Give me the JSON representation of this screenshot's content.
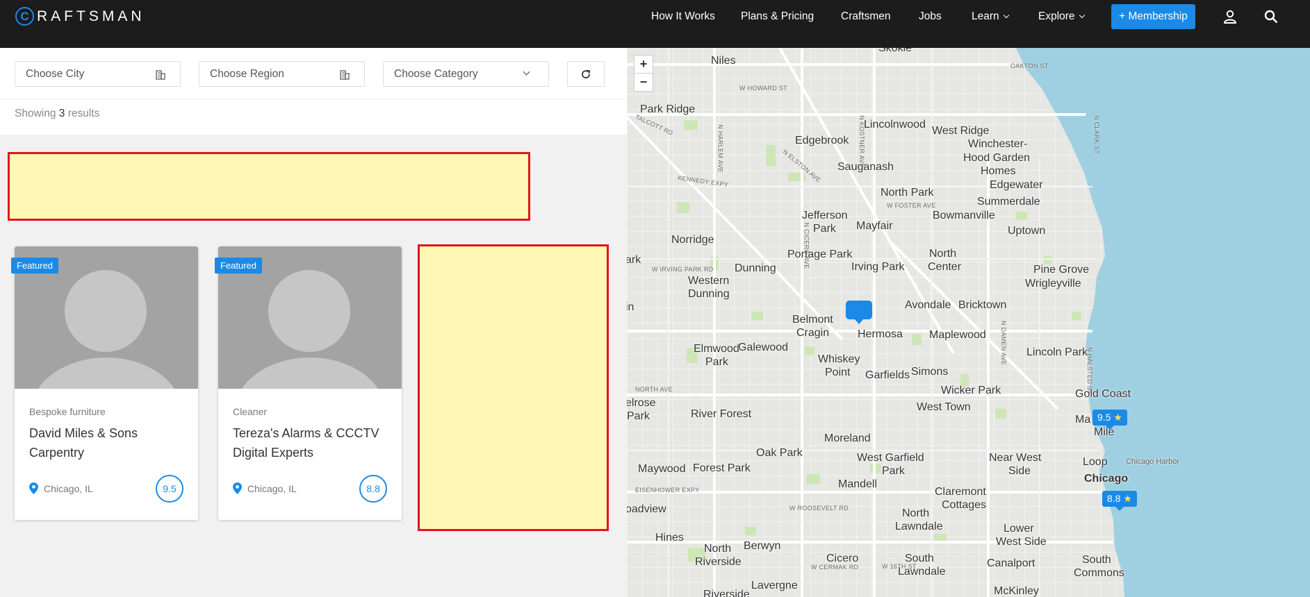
{
  "brand": {
    "logo_letter": "C",
    "logo_text": "RAFTSMAN"
  },
  "nav": {
    "how_it_works": "How It Works",
    "plans_pricing": "Plans & Pricing",
    "craftsmen": "Craftsmen",
    "jobs": "Jobs",
    "learn": "Learn",
    "explore": "Explore",
    "membership": "+ Membership",
    "icons": [
      "user-icon",
      "search-icon"
    ]
  },
  "filters": {
    "city": "Choose City",
    "region": "Choose Region",
    "category": "Choose Category"
  },
  "results": {
    "prefix": "Showing",
    "count": "3",
    "suffix": "results"
  },
  "listings": [
    {
      "badge": "Featured",
      "category": "Bespoke furniture",
      "title": "David Miles & Sons Carpentry",
      "location": "Chicago, IL",
      "score": "9.5"
    },
    {
      "badge": "Featured",
      "category": "Cleaner",
      "title": "Tereza's Alarms & CCCTV Digital Experts",
      "location": "Chicago, IL",
      "score": "8.8"
    }
  ],
  "map": {
    "zoom_in": "+",
    "zoom_out": "−",
    "markers": [
      {
        "label": "9.5",
        "star": "★"
      },
      {
        "label": "8.8",
        "star": "★"
      }
    ],
    "places": {
      "skokie": "Skokie",
      "niles": "Niles",
      "park_ridge": "Park Ridge",
      "lincolnwood": "Lincolnwood",
      "west_ridge": "West Ridge",
      "winchester": "Winchester-",
      "hood_garden": "Hood Garden",
      "homes": "Homes",
      "edgebrook": "Edgebrook",
      "sauganash": "Sauganash",
      "edgewater": "Edgewater",
      "north_park": "North Park",
      "summerdale": "Summerdale",
      "jefferson": "Jefferson",
      "park_j": "Park",
      "mayfair": "Mayfair",
      "bowmanville": "Bowmanville",
      "uptown": "Uptown",
      "norridge": "Norridge",
      "portage_park": "Portage Park",
      "north": "North",
      "center": "Center",
      "pine_grove": "Pine Grove",
      "dunning": "Dunning",
      "irving_park": "Irving Park",
      "wrigleyville": "Wrigleyville",
      "western": "Western",
      "dunning2": "Dunning",
      "avondale": "Avondale",
      "bricktown": "Bricktown",
      "belmont": "Belmont",
      "cragin": "Cragin",
      "hermosa": "Hermosa",
      "maplewood": "Maplewood",
      "elmwood": "Elmwood",
      "park_e": "Park",
      "galewood": "Galewood",
      "lincoln_park": "Lincoln Park",
      "whiskey": "Whiskey",
      "point": "Point",
      "garfields": "Garfields",
      "simons": "Simons",
      "gold_coast": "Gold Coast",
      "wicker_park": "Wicker Park",
      "elrose": "elrose",
      "park_m": "Park",
      "river_forest": "River Forest",
      "west_town": "West Town",
      "ma": "Ma",
      "mile": "Mile",
      "moreland": "Moreland",
      "oak_park": "Oak Park",
      "near_west": "Near West",
      "side": "Side",
      "west_garfield": "West Garfield",
      "park_g": "Park",
      "loop": "Loop",
      "chicago": "Chicago",
      "chicago_harbor": "Chicago Harbor",
      "maywood": "Maywood",
      "forest_park": "Forest Park",
      "mandell": "Mandell",
      "claremont": "Claremont",
      "cottages": "Cottages",
      "oadview": "oadview",
      "north_l": "North",
      "lawndale": "Lawndale",
      "lower": "Lower",
      "west_side": "West Side",
      "hines": "Hines",
      "north_r": "North",
      "riverside": "Riverside",
      "berwyn": "Berwyn",
      "cicero": "Cicero",
      "south": "South",
      "lawndale2": "Lawndale",
      "canalport": "Canalport",
      "south_c": "South",
      "commons": "Commons",
      "lavergne": "Lavergne",
      "mckinley": "McKinley",
      "riverside2": "Riverside",
      "ark": "ark",
      "in": "in"
    },
    "streets": {
      "oakton": "OAKTON ST",
      "howard": "W HOWARD ST",
      "talcott": "TALCOTT RD",
      "kennedy": "KENNEDY EXPY",
      "foster": "W FOSTER AVE",
      "irving": "W IRVING PARK RD",
      "north_ave": "NORTH AVE",
      "eisenhower": "EISENHOWER EXPY",
      "roosevelt": "W ROOSEVELT RD",
      "cermak": "W CERMAK RD",
      "harlem": "N HARLEM AVE",
      "cicero_ave": "N CICERO AVE",
      "kostner": "N KOSTNER AVE",
      "halsted": "N HALSTED ST",
      "clark": "N CLARK ST",
      "damen": "N DAMEN AVE",
      "elston": "N ELSTON AVE",
      "st16": "W 16TH ST"
    }
  }
}
